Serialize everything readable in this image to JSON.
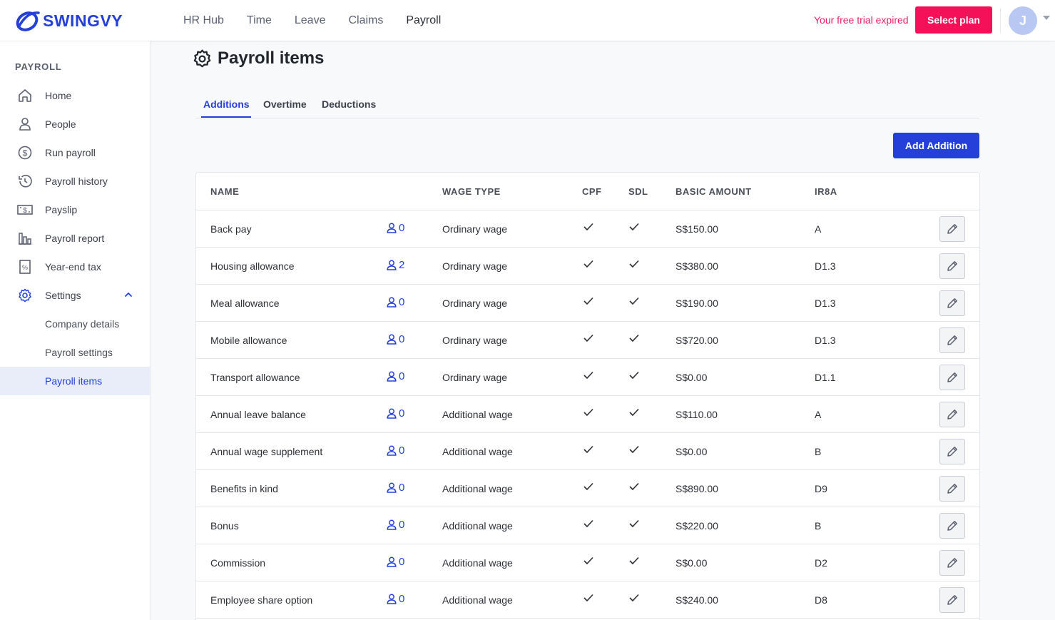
{
  "brand": {
    "name": "SWINGVY",
    "accent": "#2540d9",
    "alert": "#f5115a"
  },
  "topnav": {
    "items": [
      {
        "label": "HR Hub"
      },
      {
        "label": "Time"
      },
      {
        "label": "Leave"
      },
      {
        "label": "Claims"
      },
      {
        "label": "Payroll",
        "active": true
      }
    ],
    "trial_text": "Your free trial expired",
    "select_plan_label": "Select plan",
    "avatar_initial": "J"
  },
  "sidebar": {
    "heading": "PAYROLL",
    "items": [
      {
        "label": "Home",
        "icon": "home-icon"
      },
      {
        "label": "People",
        "icon": "person-icon"
      },
      {
        "label": "Run payroll",
        "icon": "dollar-cycle-icon"
      },
      {
        "label": "Payroll history",
        "icon": "history-icon"
      },
      {
        "label": "Payslip",
        "icon": "payslip-icon"
      },
      {
        "label": "Payroll report",
        "icon": "report-icon"
      },
      {
        "label": "Year-end tax",
        "icon": "tax-icon"
      },
      {
        "label": "Settings",
        "icon": "gear-icon",
        "expanded": true
      }
    ],
    "subitems": [
      {
        "label": "Company details"
      },
      {
        "label": "Payroll settings"
      },
      {
        "label": "Payroll items",
        "active": true
      }
    ]
  },
  "page": {
    "title": "Payroll items",
    "tabs": [
      {
        "label": "Additions",
        "active": true
      },
      {
        "label": "Overtime"
      },
      {
        "label": "Deductions"
      }
    ],
    "add_button_label": "Add Addition"
  },
  "table": {
    "columns": [
      "NAME",
      "WAGE TYPE",
      "CPF",
      "SDL",
      "BASIC AMOUNT",
      "IR8A"
    ],
    "rows": [
      {
        "name": "Back pay",
        "assigned": "0",
        "wage_type": "Ordinary wage",
        "cpf": true,
        "sdl": true,
        "amount": "S$150.00",
        "ir8a": "A"
      },
      {
        "name": "Housing allowance",
        "assigned": "2",
        "wage_type": "Ordinary wage",
        "cpf": true,
        "sdl": true,
        "amount": "S$380.00",
        "ir8a": "D1.3"
      },
      {
        "name": "Meal allowance",
        "assigned": "0",
        "wage_type": "Ordinary wage",
        "cpf": true,
        "sdl": true,
        "amount": "S$190.00",
        "ir8a": "D1.3"
      },
      {
        "name": "Mobile allowance",
        "assigned": "0",
        "wage_type": "Ordinary wage",
        "cpf": true,
        "sdl": true,
        "amount": "S$720.00",
        "ir8a": "D1.3"
      },
      {
        "name": "Transport allowance",
        "assigned": "0",
        "wage_type": "Ordinary wage",
        "cpf": true,
        "sdl": true,
        "amount": "S$0.00",
        "ir8a": "D1.1"
      },
      {
        "name": "Annual leave balance",
        "assigned": "0",
        "wage_type": "Additional wage",
        "cpf": true,
        "sdl": true,
        "amount": "S$110.00",
        "ir8a": "A"
      },
      {
        "name": "Annual wage supplement",
        "assigned": "0",
        "wage_type": "Additional wage",
        "cpf": true,
        "sdl": true,
        "amount": "S$0.00",
        "ir8a": "B"
      },
      {
        "name": "Benefits in kind",
        "assigned": "0",
        "wage_type": "Additional wage",
        "cpf": true,
        "sdl": true,
        "amount": "S$890.00",
        "ir8a": "D9"
      },
      {
        "name": "Bonus",
        "assigned": "0",
        "wage_type": "Additional wage",
        "cpf": true,
        "sdl": true,
        "amount": "S$220.00",
        "ir8a": "B"
      },
      {
        "name": "Commission",
        "assigned": "0",
        "wage_type": "Additional wage",
        "cpf": true,
        "sdl": true,
        "amount": "S$0.00",
        "ir8a": "D2"
      },
      {
        "name": "Employee share option",
        "assigned": "0",
        "wage_type": "Additional wage",
        "cpf": true,
        "sdl": true,
        "amount": "S$240.00",
        "ir8a": "D8"
      }
    ]
  }
}
